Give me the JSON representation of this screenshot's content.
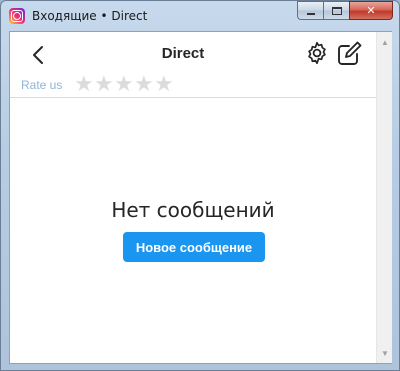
{
  "window": {
    "title": "Входящие • Direct",
    "icon": "instagram-icon"
  },
  "header": {
    "title": "Direct",
    "back_icon": "chevron-left-icon",
    "settings_icon": "gear-icon",
    "compose_icon": "compose-icon"
  },
  "rating": {
    "label": "Rate us",
    "stars": [
      "★",
      "★",
      "★",
      "★",
      "★"
    ],
    "value": 0,
    "max": 5,
    "star_color": "#dcdcdc"
  },
  "main": {
    "empty_text": "Нет сообщений",
    "new_message_label": "Новое сообщение",
    "accent": "#1a95f0"
  },
  "scrollbar": {
    "up": "▲",
    "down": "▼"
  }
}
